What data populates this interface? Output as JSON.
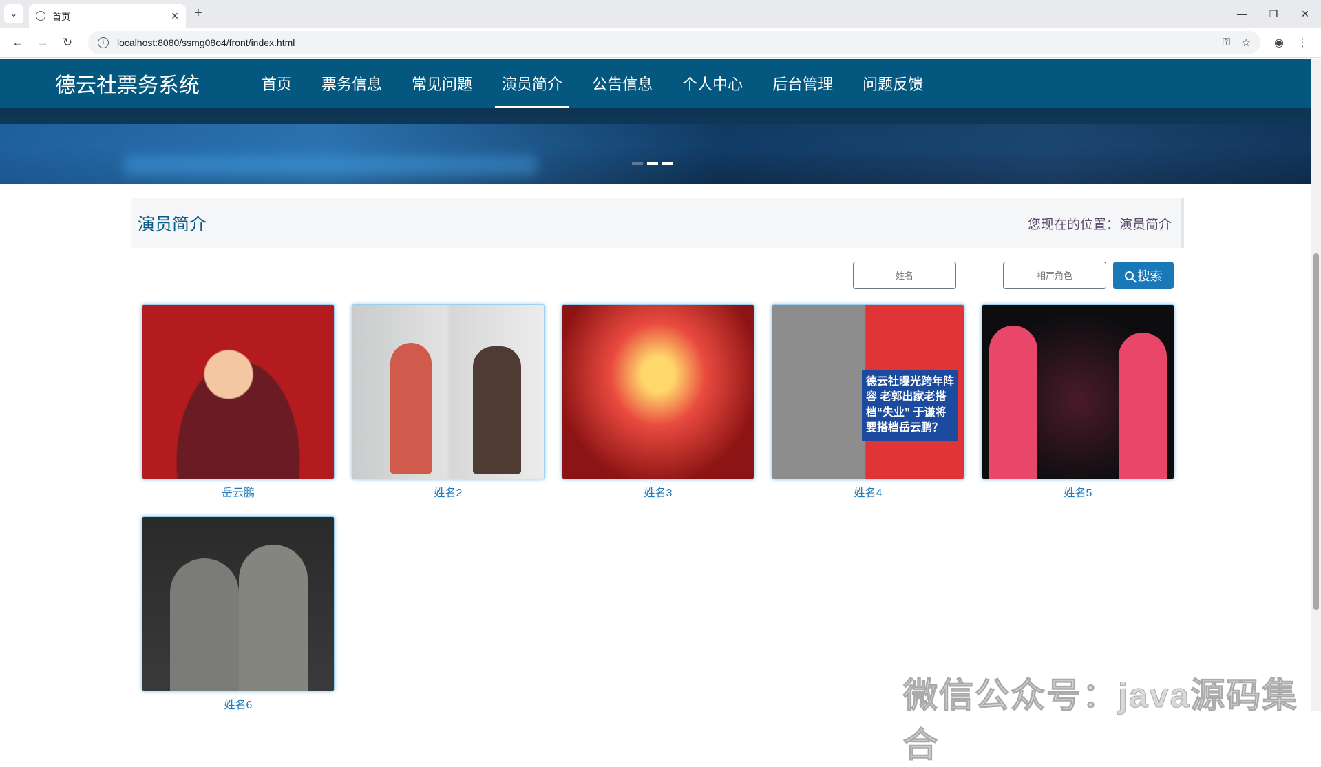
{
  "browser": {
    "tab_title": "首页",
    "url": "localhost:8080/ssmg08o4/front/index.html"
  },
  "nav": {
    "brand": "德云社票务系统",
    "items": [
      {
        "label": "首页",
        "active": false
      },
      {
        "label": "票务信息",
        "active": false
      },
      {
        "label": "常见问题",
        "active": false
      },
      {
        "label": "演员简介",
        "active": true
      },
      {
        "label": "公告信息",
        "active": false
      },
      {
        "label": "个人中心",
        "active": false
      },
      {
        "label": "后台管理",
        "active": false
      },
      {
        "label": "问题反馈",
        "active": false
      }
    ]
  },
  "section": {
    "title": "演员简介",
    "location": "您现在的位置：演员简介"
  },
  "search": {
    "name_placeholder": "姓名",
    "role_placeholder": "相声角色",
    "button_label": "搜索"
  },
  "actors": [
    {
      "name": "岳云鹏"
    },
    {
      "name": "姓名2"
    },
    {
      "name": "姓名3"
    },
    {
      "name": "姓名4",
      "poster_text": "德云社曝光跨年阵容 老郭出家老搭档“失业” 于谦将要搭档岳云鹏？"
    },
    {
      "name": "姓名5"
    },
    {
      "name": "姓名6"
    }
  ],
  "watermark": "微信公众号：java源码集合"
}
